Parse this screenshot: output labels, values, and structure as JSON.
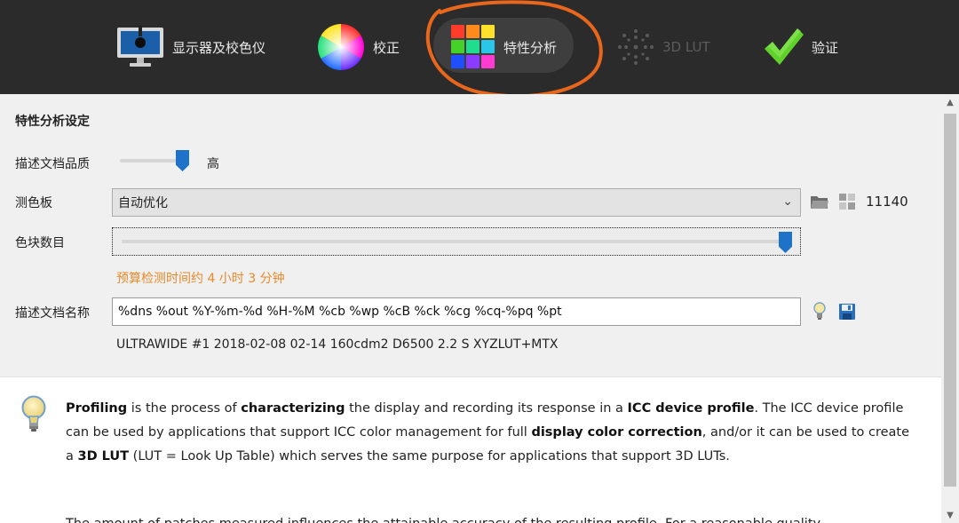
{
  "toolbar": {
    "tabs": [
      {
        "label": "显示器及校色仪",
        "icon": "monitor-icon"
      },
      {
        "label": "校正",
        "icon": "color-wheel-icon"
      },
      {
        "label": "特性分析",
        "icon": "color-grid-icon",
        "active": true
      },
      {
        "label": "3D LUT",
        "icon": "lut-icon",
        "disabled": true
      },
      {
        "label": "验证",
        "icon": "checkmark-icon"
      }
    ]
  },
  "settings": {
    "title": "特性分析设定",
    "quality": {
      "label": "描述文档品质",
      "value_text": "高",
      "level": 1.0
    },
    "testchart": {
      "label": "测色板",
      "value": "自动优化",
      "patch_count": "11140"
    },
    "patches": {
      "label": "色块数目",
      "level": 1.0
    },
    "estimate": "预算检测时间约 4 小时 3 分钟",
    "profile_name": {
      "label": "描述文档名称",
      "value": "%dns %out %Y-%m-%d %H-%M %cb %wp %cB %ck %cg %cq-%pq %pt"
    },
    "preview": "ULTRAWIDE #1 2018-02-08 02-14 160cdm2 D6500 2.2 S XYZLUT+MTX"
  },
  "info": {
    "p1": [
      {
        "t": "Profiling",
        "b": true
      },
      {
        "t": " is the process of "
      },
      {
        "t": "characterizing",
        "b": true
      },
      {
        "t": " the display and recording its response in a "
      },
      {
        "t": "ICC device profile",
        "b": true
      },
      {
        "t": ". The ICC device profile can be used by applications that support ICC color management for full "
      },
      {
        "t": "display color correction",
        "b": true
      },
      {
        "t": ", and/or it can be used to create a "
      },
      {
        "t": "3D LUT",
        "b": true
      },
      {
        "t": " (LUT = Look Up Table) which serves the same purpose for applications that support 3D LUTs."
      }
    ],
    "p2": "The amount of patches measured influences the attainable accuracy of the resulting profile. For a reasonable quality"
  },
  "colors": {
    "toolbar_bg": "#2b2b2b",
    "accent_blue": "#1e73c8",
    "estimate_orange": "#e88a2a",
    "highlight_circle": "#e8671c"
  }
}
